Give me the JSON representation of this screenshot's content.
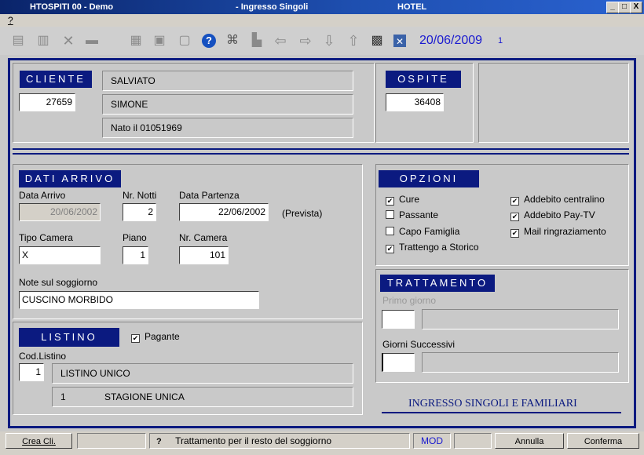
{
  "window": {
    "app": "HTOSPITI 00 - Demo",
    "title": "- Ingresso Singoli",
    "hotel": "HOTEL",
    "min": "_",
    "max": "□",
    "close": "X"
  },
  "menu": {
    "help": "?"
  },
  "toolbar": {
    "date": "20/06/2009",
    "counter": "1"
  },
  "cliente": {
    "header": "CLIENTE",
    "code": "27659",
    "surname": "SALVIATO",
    "name": "SIMONE",
    "birth": "Nato il 01051969"
  },
  "ospite": {
    "header": "OSPITE",
    "code": "36408"
  },
  "arrivo": {
    "header": "DATI ARRIVO",
    "data_arrivo_label": "Data Arrivo",
    "data_arrivo": "20/06/2002",
    "notti_label": "Nr. Notti",
    "notti": "2",
    "partenza_label": "Data Partenza",
    "partenza": "22/06/2002",
    "prevista": "(Prevista)",
    "tipo_camera_label": "Tipo Camera",
    "tipo_camera": "X",
    "piano_label": "Piano",
    "piano": "1",
    "nr_camera_label": "Nr. Camera",
    "nr_camera": "101",
    "note_label": "Note sul soggiorno",
    "note": "CUSCINO MORBIDO"
  },
  "opzioni": {
    "header": "OPZIONI",
    "items": [
      {
        "label": "Cure",
        "checked": true
      },
      {
        "label": "Passante",
        "checked": false
      },
      {
        "label": "Capo Famiglia",
        "checked": false
      },
      {
        "label": "Trattengo a Storico",
        "checked": true
      },
      {
        "label": "Addebito centralino",
        "checked": true
      },
      {
        "label": "Addebito Pay-TV",
        "checked": true
      },
      {
        "label": "Mail ringraziamento",
        "checked": true
      }
    ]
  },
  "trattamento": {
    "header": "TRATTAMENTO",
    "primo_label": "Primo giorno",
    "successivi_label": "Giorni Successivi"
  },
  "listino": {
    "header": "LISTINO",
    "pagante": "Pagante",
    "cod_label": "Cod.Listino",
    "cod": "1",
    "name": "LISTINO UNICO",
    "stagione_num": "1",
    "stagione": "STAGIONE UNICA"
  },
  "footer_title": "INGRESSO SINGOLI E FAMILIARI",
  "status": {
    "crea": "Crea Cli.",
    "q": "?",
    "message": "Trattamento per il resto del soggiorno",
    "mode": "MOD",
    "annulla": "Annulla",
    "conferma": "Conferma"
  }
}
